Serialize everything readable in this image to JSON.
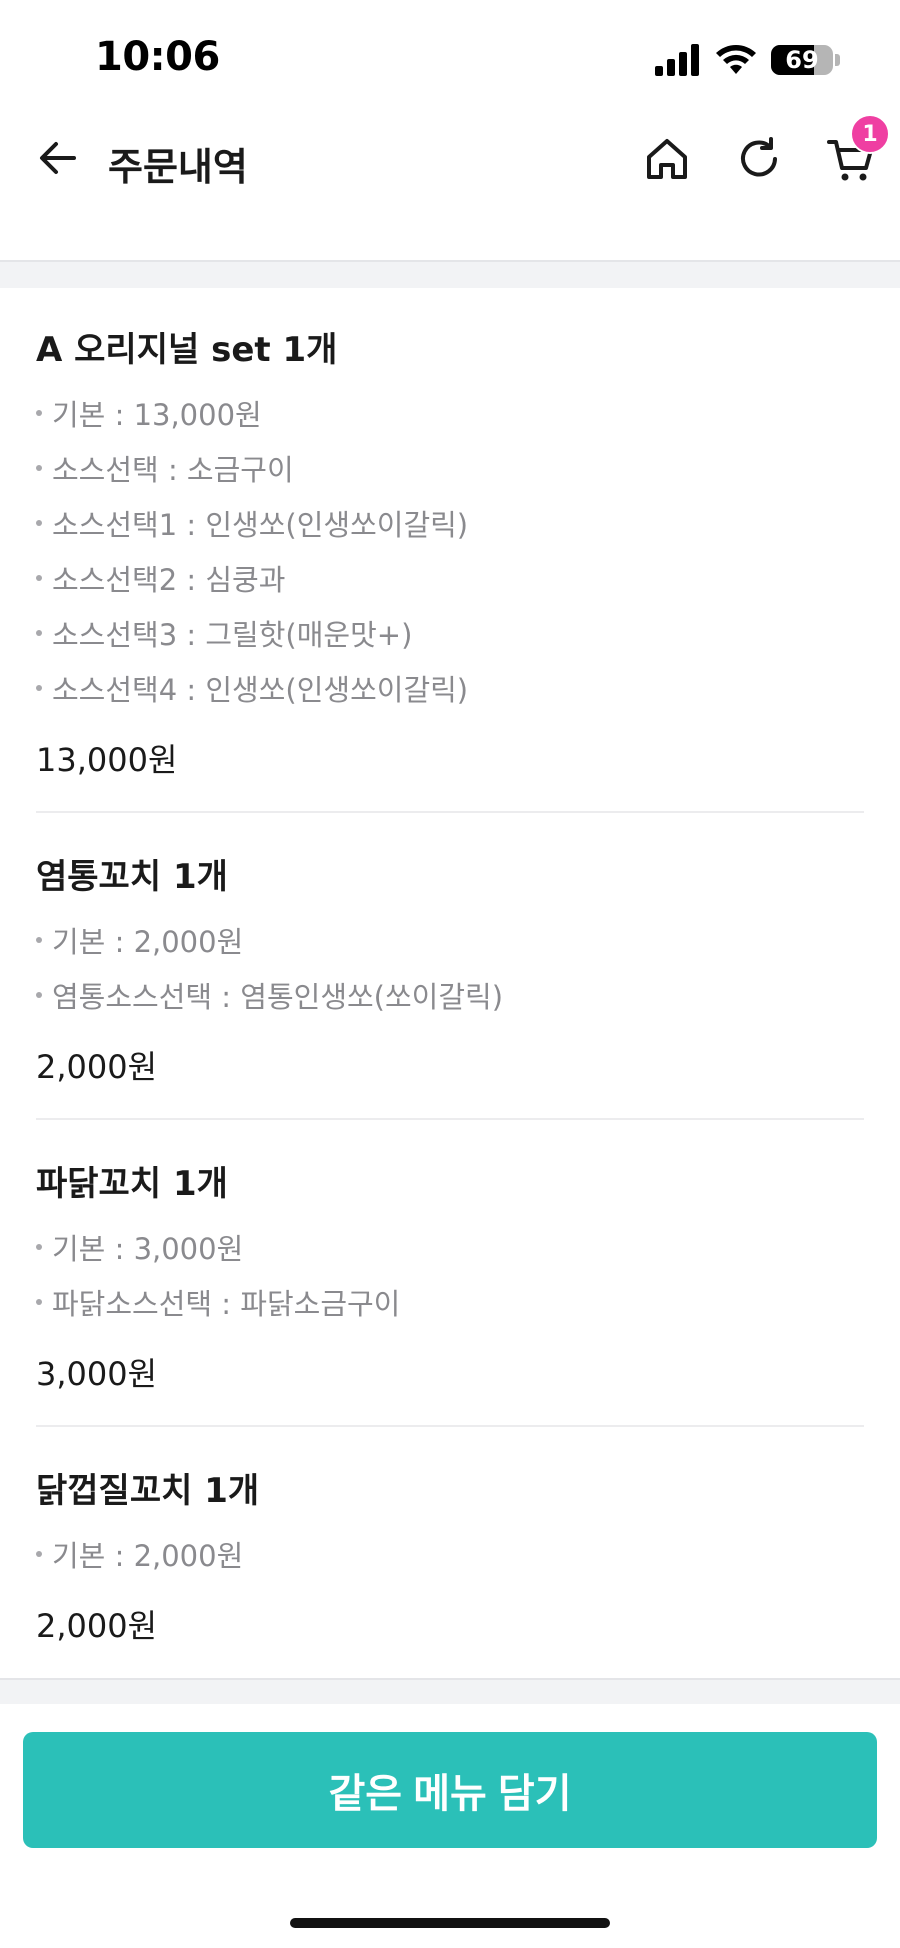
{
  "status_bar": {
    "time": "10:06",
    "battery_percent": "69",
    "battery_level": 0.69
  },
  "header": {
    "title": "주문내역",
    "cart_count": "1",
    "icons": {
      "back": "back-arrow-icon",
      "home": "home-icon",
      "refresh": "refresh-icon",
      "cart": "cart-icon"
    }
  },
  "order": {
    "items": [
      {
        "name": "A 오리지널 set 1개",
        "options": [
          "기본 : 13,000원",
          "소스선택 : 소금구이",
          "소스선택1 : 인생쏘(인생쏘이갈릭)",
          "소스선택2 : 심쿵과",
          "소스선택3 : 그릴핫(매운맛+)",
          "소스선택4 : 인생쏘(인생쏘이갈릭)"
        ],
        "price": "13,000원"
      },
      {
        "name": "염통꼬치 1개",
        "options": [
          "기본 : 2,000원",
          "염통소스선택 : 염통인생쏘(쏘이갈릭)"
        ],
        "price": "2,000원"
      },
      {
        "name": "파닭꼬치 1개",
        "options": [
          "기본 : 3,000원",
          "파닭소스선택 : 파닭소금구이"
        ],
        "price": "3,000원"
      },
      {
        "name": "닭껍질꼬치 1개",
        "options": [
          "기본 : 2,000원"
        ],
        "price": "2,000원"
      }
    ]
  },
  "cta": {
    "label": "같은 메뉴 담기"
  },
  "colors": {
    "accent": "#2bc0b8",
    "badge": "#ef3fa2",
    "option_text": "#8a8a8e"
  }
}
